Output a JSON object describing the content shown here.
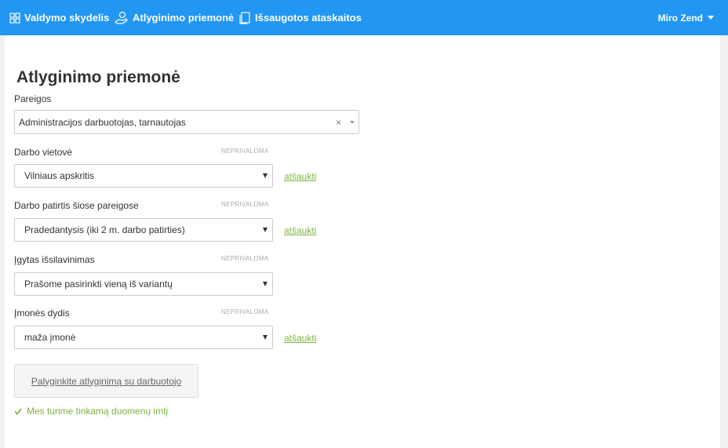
{
  "nav": {
    "items": [
      {
        "label": "Valdymo skydelis",
        "icon": "dashboard-grid-icon"
      },
      {
        "label": "Atlyginimo priemonė",
        "icon": "money-hand-icon"
      },
      {
        "label": "Išsaugotos ataskaitos",
        "icon": "documents-icon"
      }
    ],
    "user": "Miro Zend"
  },
  "page": {
    "title": "Atlyginimo priemonė"
  },
  "form": {
    "position": {
      "label": "Pareigos",
      "value": "Administracijos darbuotojas, tarnautojas"
    },
    "location": {
      "label": "Darbo vietovė",
      "optional": "NEPRIVALOMA",
      "value": "Vilniaus apskritis",
      "cancel": "atšaukti"
    },
    "experience": {
      "label": "Darbo patirtis šiose pareigose",
      "optional": "NEPRIVALOMA",
      "value": "Pradedantysis (iki 2 m. darbo patirties)",
      "cancel": "atšaukti"
    },
    "education": {
      "label": "Įgytas išsilavinimas",
      "optional": "NEPRIVALOMA",
      "value": "Prašome pasirinkti vieną iš variantų"
    },
    "company_size": {
      "label": "Įmonės dydis",
      "optional": "NEPRIVALOMA",
      "value": "maža įmonė",
      "cancel": "atšaukti"
    },
    "compare_button": "Palyginkite atlyginimą su darbuotojo",
    "status": "Mes turime tinkamą duomenų imtį"
  },
  "colors": {
    "navbar": "#2196f3",
    "accent_green": "#7cb342"
  }
}
